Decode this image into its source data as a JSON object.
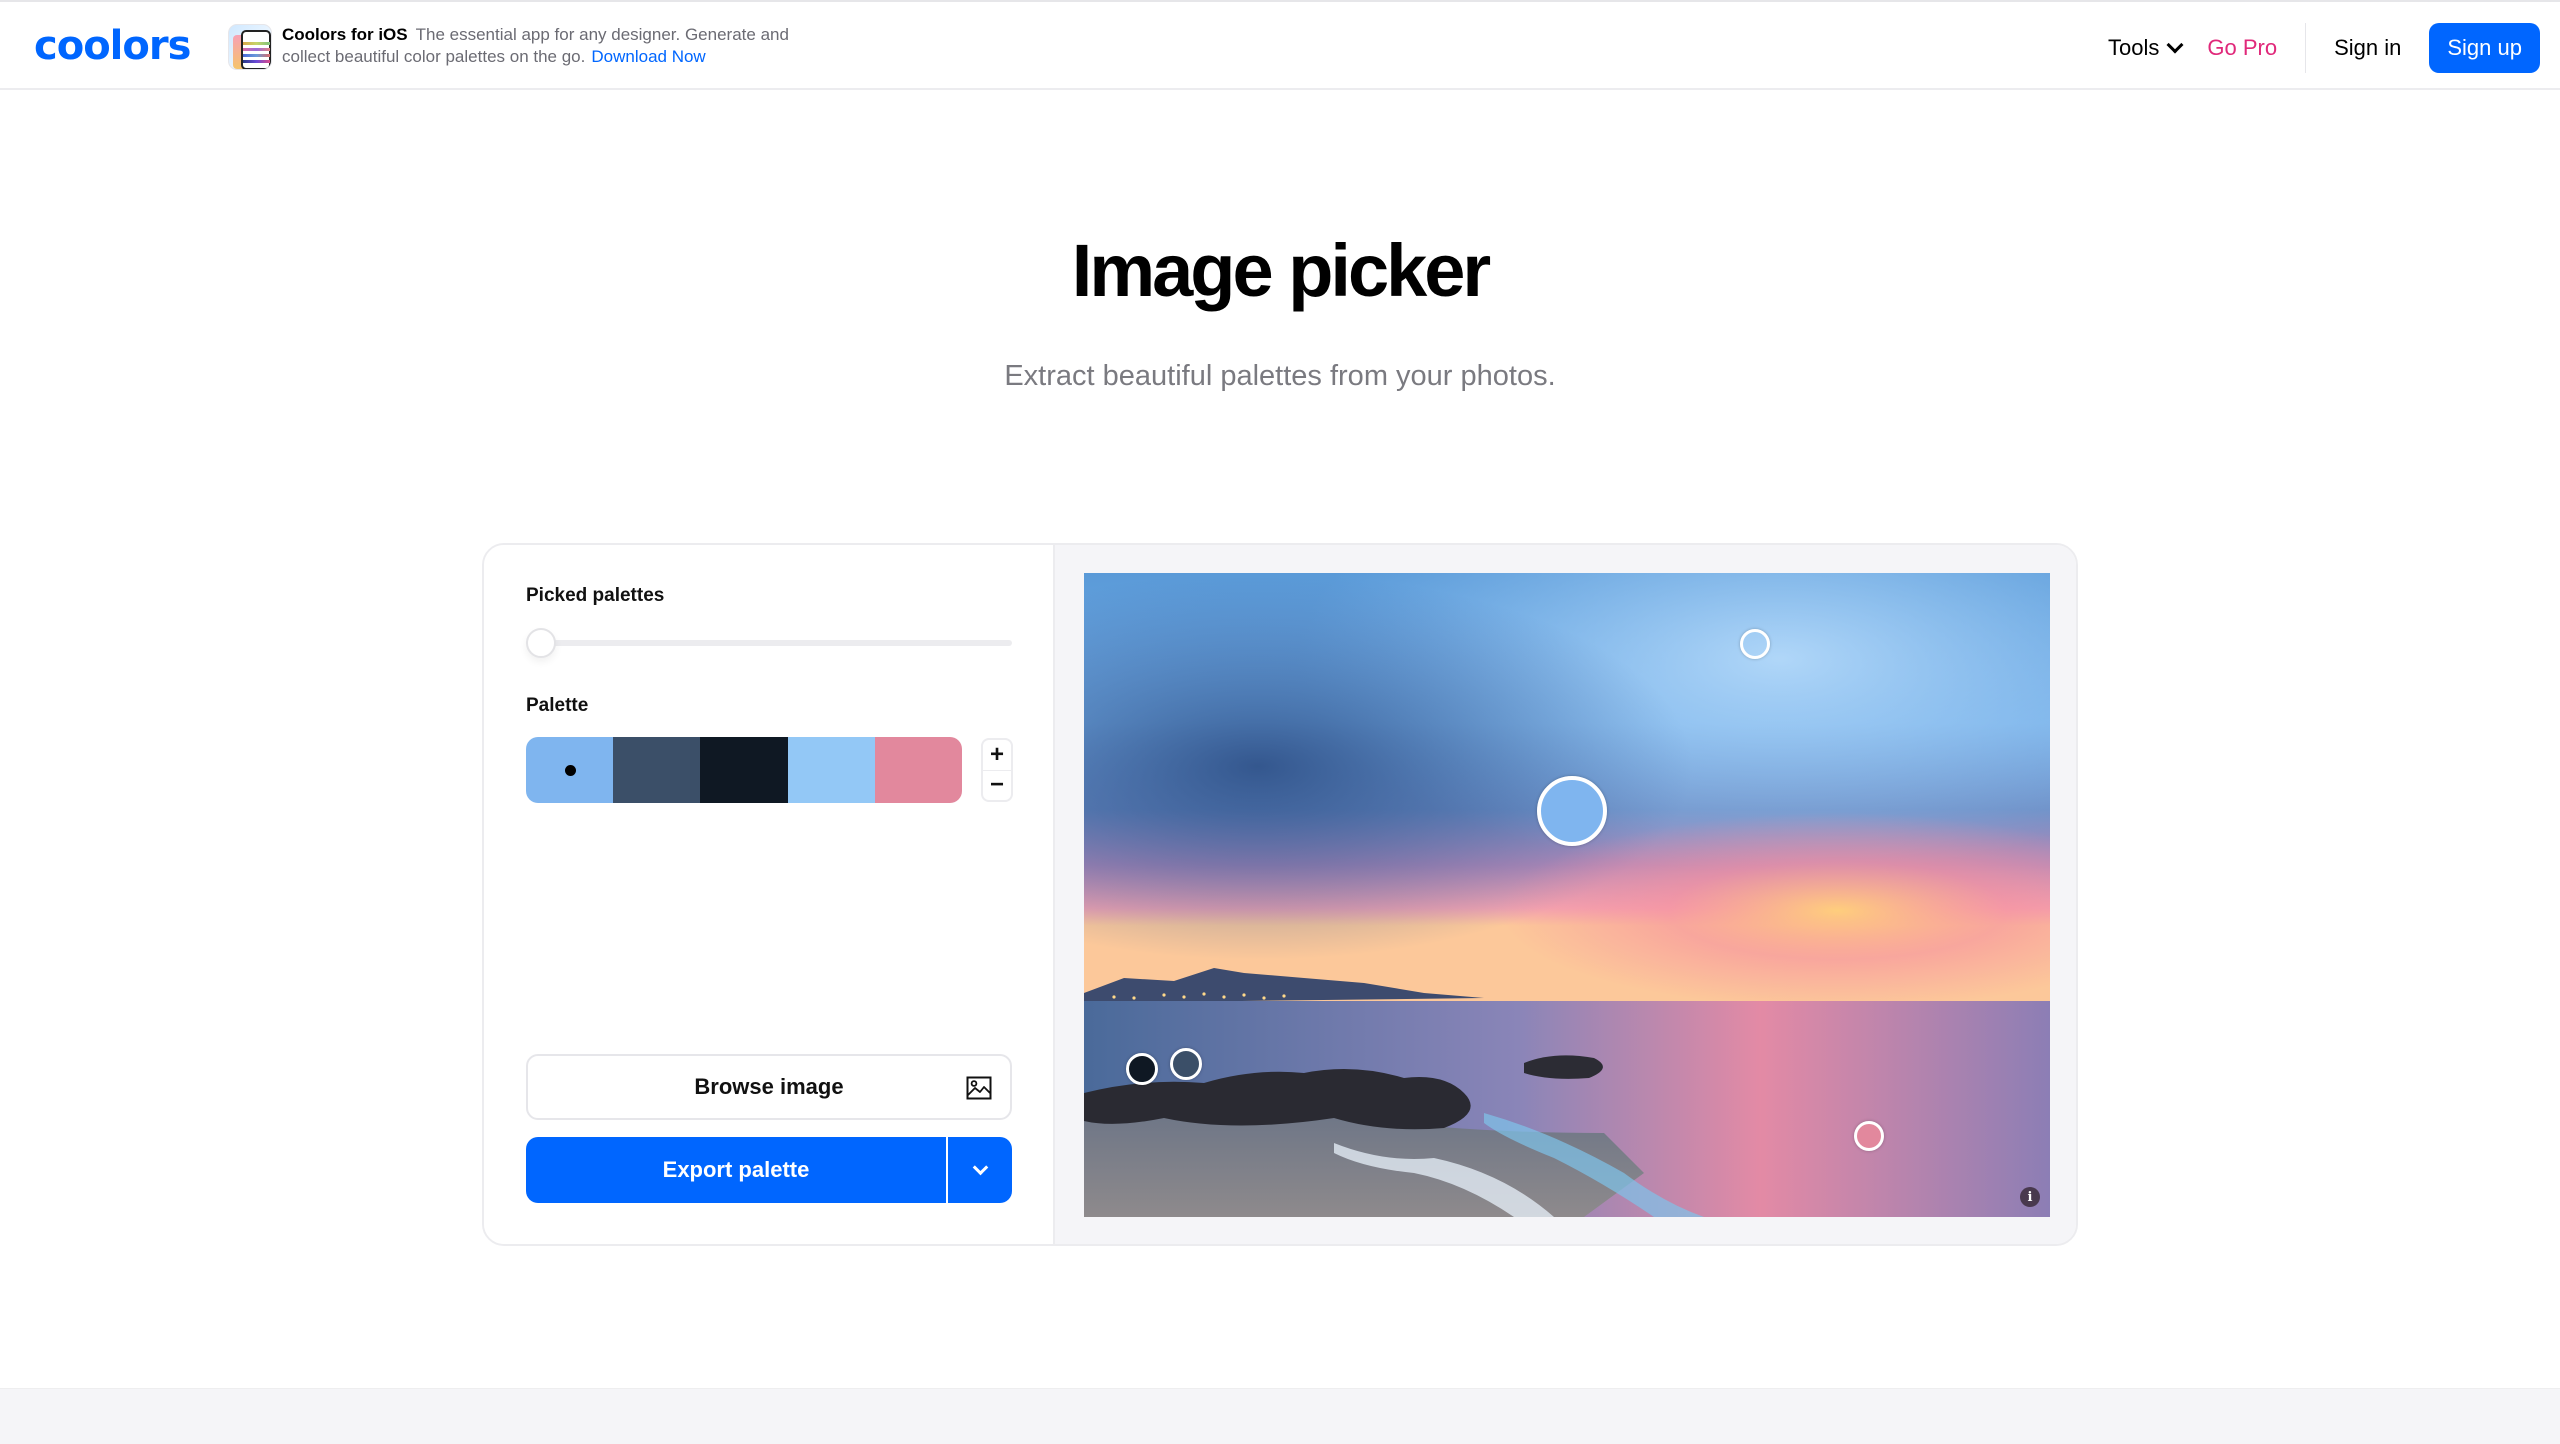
{
  "nav": {
    "logo": "coolors",
    "promo": {
      "title": "Coolors for iOS",
      "text": "The essential app for any designer. Generate and collect beautiful color palettes on the go.",
      "link": "Download Now",
      "icon": "ios-app-icon"
    },
    "tools_label": "Tools",
    "gopro_label": "Go Pro",
    "signin_label": "Sign in",
    "signup_label": "Sign up"
  },
  "hero": {
    "title": "Image picker",
    "subtitle": "Extract beautiful palettes from your photos."
  },
  "panel": {
    "picked_palettes_label": "Picked palettes",
    "picked_palettes_slider_value": 0,
    "palette_label": "Palette",
    "palette_colors": [
      "#7fb5ef",
      "#3b4f68",
      "#0f1823",
      "#93c8f6",
      "#e2889d"
    ],
    "selected_swatch_index": 0,
    "add_color_label": "+",
    "remove_color_label": "−",
    "browse_label": "Browse image",
    "browse_icon": "image-icon",
    "export_label": "Export palette",
    "export_dropdown_icon": "chevron-down-icon"
  },
  "photo": {
    "info_label": "i",
    "pickers": [
      {
        "color": "#7fb5ef",
        "selected": true
      },
      {
        "color": "#3b4f68",
        "selected": false
      },
      {
        "color": "#0f1823",
        "selected": false
      },
      {
        "color": "#93c8f6",
        "selected": false
      },
      {
        "color": "#e2889d",
        "selected": false
      }
    ]
  },
  "colors": {
    "brand": "#0066ff",
    "gopro": "#e0287a"
  }
}
